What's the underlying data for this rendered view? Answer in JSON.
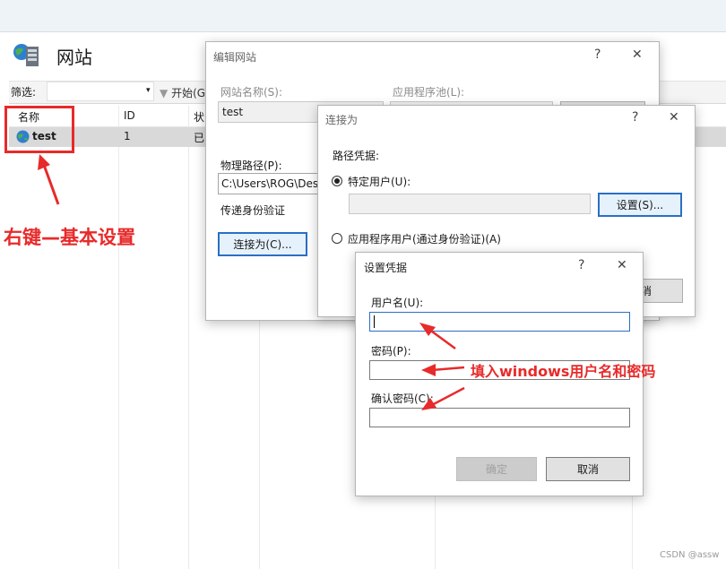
{
  "page": {
    "title": "网站",
    "filter_label": "筛选:",
    "filter_start": "开始(G",
    "columns": [
      "名称",
      "ID",
      "状"
    ],
    "rows": [
      {
        "name": "test",
        "id": "1",
        "status": "已"
      }
    ]
  },
  "annotations": {
    "right_click": "右键—基本设置",
    "fill_in": "填入windows用户名和密码",
    "watermark": "CSDN @assw"
  },
  "edit_site_dialog": {
    "title": "编辑网站",
    "help": "?",
    "close": "✕",
    "site_name_label": "网站名称(S):",
    "site_name_value": "test",
    "app_pool_label": "应用程序池(L):",
    "physical_path_label": "物理路径(P):",
    "physical_path_value": "C:\\Users\\ROG\\Desk",
    "pass_auth_label": "传递身份验证",
    "connect_as_button": "连接为(C)..."
  },
  "connect_as_dialog": {
    "title": "连接为",
    "help": "?",
    "close": "✕",
    "path_credentials_label": "路径凭据:",
    "specific_user_label": "特定用户(U):",
    "settings_button": "设置(S)...",
    "app_user_label": "应用程序用户(通过身份验证)(A)",
    "cancel_fragment": "消"
  },
  "credentials_dialog": {
    "title": "设置凭据",
    "help": "?",
    "close": "✕",
    "username_label": "用户名(U):",
    "password_label": "密码(P):",
    "confirm_label": "确认密码(C):",
    "ok_button": "确定",
    "cancel_button": "取消"
  },
  "colors": {
    "annotation_red": "#e82a2a",
    "focus_blue": "#2b6fc4"
  }
}
